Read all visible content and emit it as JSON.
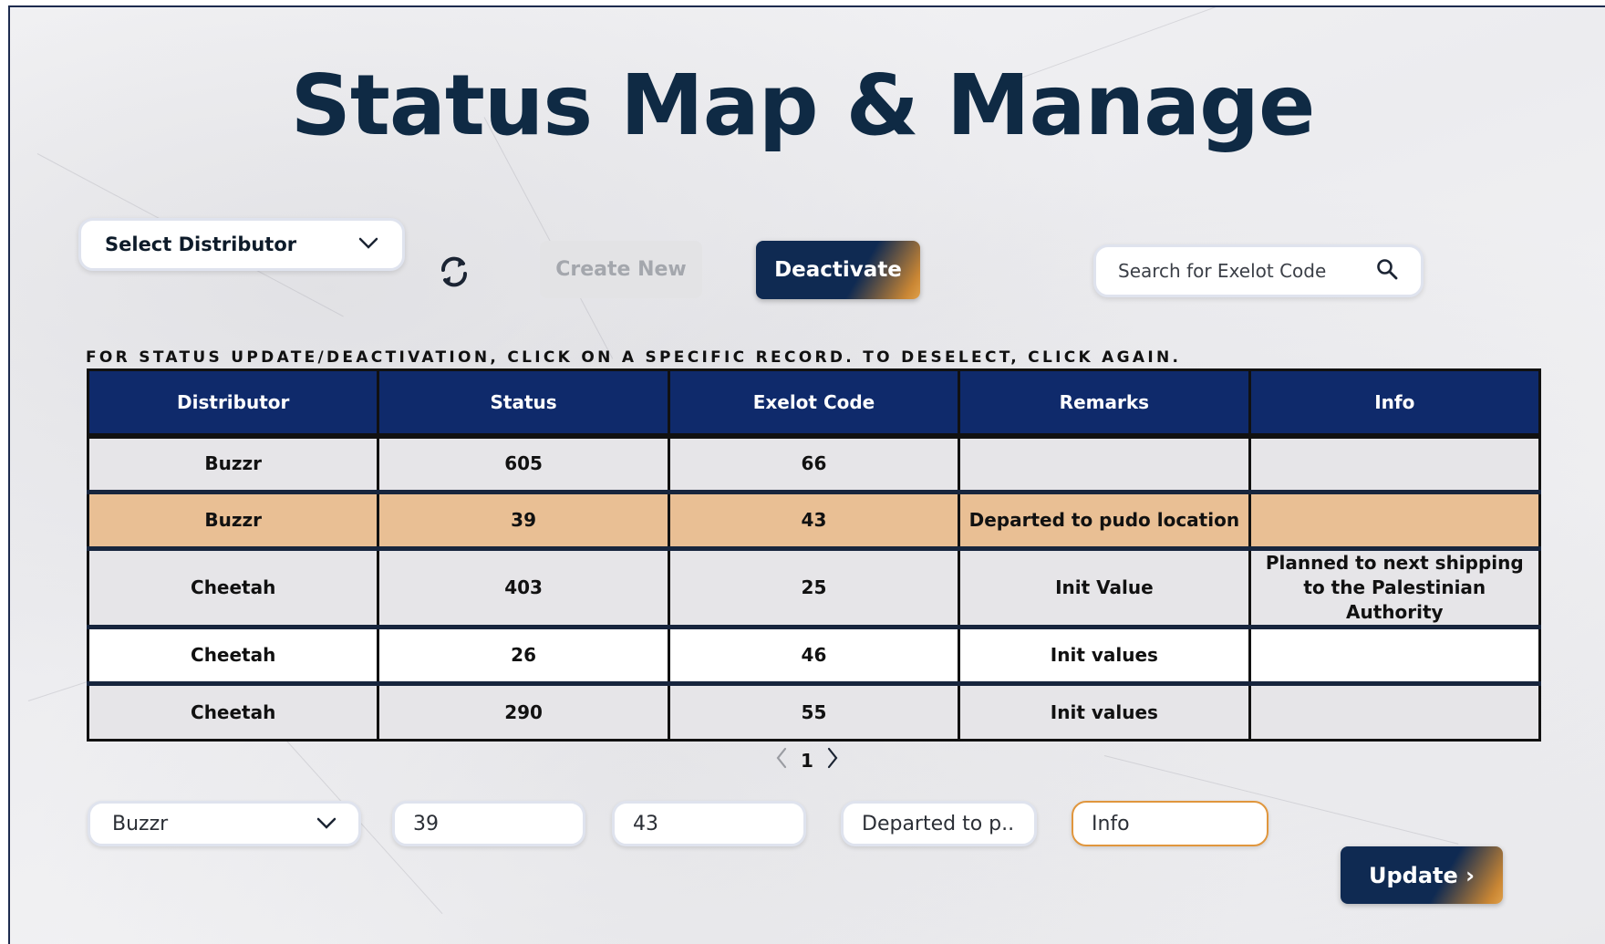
{
  "page": {
    "title": "Status Map & Manage"
  },
  "toolbar": {
    "distributor_select_label": "Select Distributor",
    "create_label": "Create New",
    "deactivate_label": "Deactivate",
    "search_placeholder": "Search for Exelot Code"
  },
  "instruction": "FOR STATUS UPDATE/DEACTIVATION, CLICK ON A SPECIFIC RECORD. TO DESELECT, CLICK AGAIN.",
  "table": {
    "headers": [
      "Distributor",
      "Status",
      "Exelot Code",
      "Remarks",
      "Info"
    ],
    "rows": [
      [
        "Buzzr",
        "605",
        "66",
        "",
        ""
      ],
      [
        "Buzzr",
        "39",
        "43",
        "Departed to pudo location",
        ""
      ],
      [
        "Cheetah",
        "403",
        "25",
        "Init Value",
        "Planned to next shipping to the Palestinian Authority"
      ],
      [
        "Cheetah",
        "26",
        "46",
        "Init values",
        ""
      ],
      [
        "Cheetah",
        "290",
        "55",
        "Init values",
        ""
      ]
    ],
    "selected_row": 1
  },
  "pagination": {
    "current_page": "1"
  },
  "edit_form": {
    "distributor": "Buzzr",
    "status": "39",
    "exelot_code": "43",
    "remarks": "Departed to p...",
    "info_placeholder": "Info",
    "update_label": "Update ›"
  },
  "colors": {
    "header_bg": "#0f2a6b",
    "selected_row": "#e9bf94",
    "title": "#0f2a44",
    "accent": "#e0963d"
  }
}
